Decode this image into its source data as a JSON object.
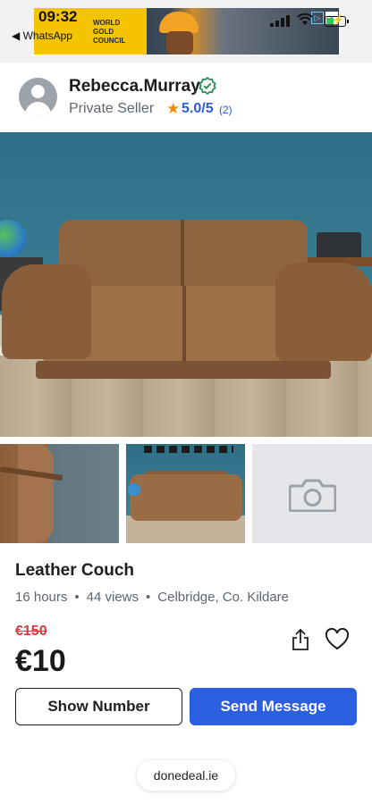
{
  "status_bar": {
    "time": "09:32",
    "back_app": "◀ WhatsApp",
    "ad_lines": [
      "WORLD",
      "GOLD",
      "COUNCIL"
    ]
  },
  "seller": {
    "name": "Rebecca.Murray",
    "type": "Private Seller",
    "rating": "5.0/5",
    "rating_count": "(2)",
    "verified_icon": "verified-check-icon",
    "accent_color": "#2b5bdc",
    "star_color": "#f28b00"
  },
  "photos": {
    "main_alt": "leather couch photo",
    "thumbnails": [
      "couch-closeup",
      "couch-room",
      "camera-placeholder"
    ]
  },
  "listing": {
    "title": "Leather Couch",
    "age": "16 hours",
    "views": "44 views",
    "location": "Celbridge, Co. Kildare",
    "old_price": "€150",
    "price": "€10",
    "old_price_color": "#d23b3b"
  },
  "actions": {
    "show_number": "Show Number",
    "send_message": "Send Message",
    "primary_color": "#2b5fe0"
  },
  "browser": {
    "url": "donedeal.ie"
  }
}
